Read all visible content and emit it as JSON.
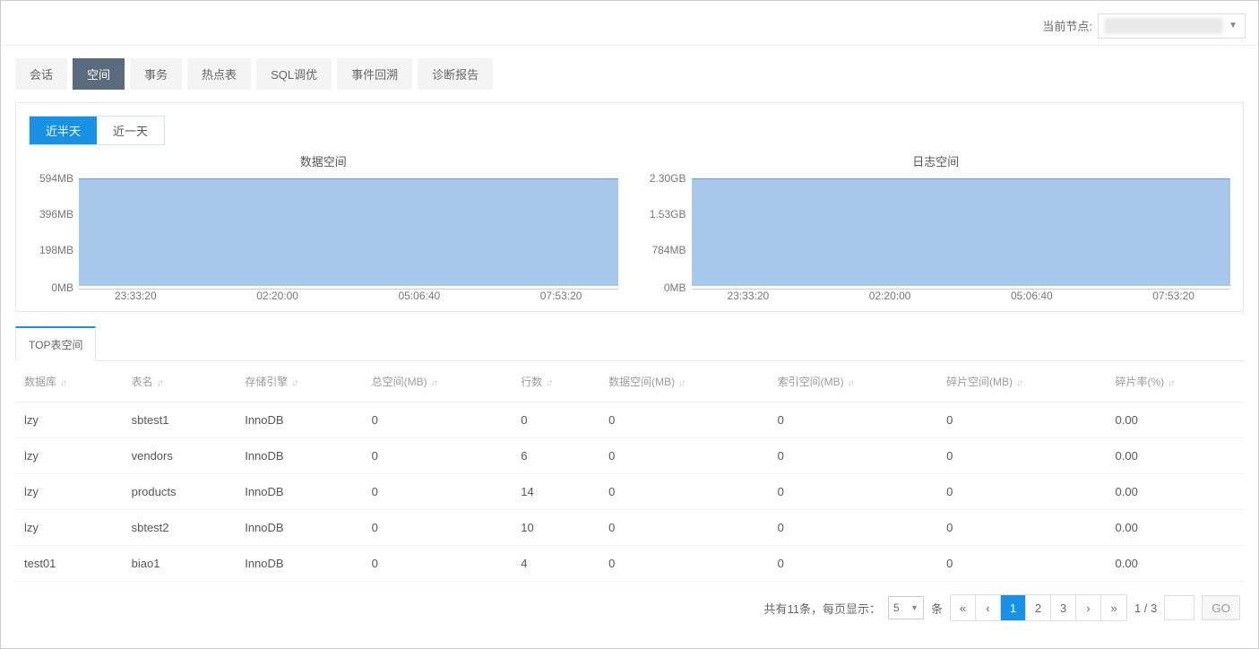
{
  "header": {
    "current_node_label": "当前节点:",
    "current_node_value": ""
  },
  "nav_tabs": [
    "会话",
    "空间",
    "事务",
    "热点表",
    "SQL调优",
    "事件回溯",
    "诊断报告"
  ],
  "nav_active_index": 1,
  "range_toggle": {
    "options": [
      "近半天",
      "近一天"
    ],
    "active_index": 0
  },
  "chart_data": [
    {
      "type": "area",
      "title": "数据空间",
      "y_ticks": [
        "0MB",
        "198MB",
        "396MB",
        "594MB"
      ],
      "ylim": [
        0,
        594
      ],
      "x_ticks": [
        "23:33:20",
        "02:20:00",
        "05:06:40",
        "07:53:20"
      ],
      "series": [
        {
          "name": "数据空间",
          "value_constant_mb": 594
        }
      ]
    },
    {
      "type": "area",
      "title": "日志空间",
      "y_ticks": [
        "0MB",
        "784MB",
        "1.53GB",
        "2.30GB"
      ],
      "ylim": [
        0,
        2355
      ],
      "x_ticks": [
        "23:33:20",
        "02:20:00",
        "05:06:40",
        "07:53:20"
      ],
      "series": [
        {
          "name": "日志空间",
          "value_constant_mb": 2355
        }
      ]
    }
  ],
  "sub_tab": "TOP表空间",
  "table": {
    "columns": [
      "数据库",
      "表名",
      "存储引擎",
      "总空间(MB)",
      "行数",
      "数据空间(MB)",
      "索引空间(MB)",
      "碎片空间(MB)",
      "碎片率(%)"
    ],
    "rows": [
      {
        "db": "lzy",
        "table": "sbtest1",
        "engine": "InnoDB",
        "total": "0",
        "rows": "0",
        "data": "0",
        "idx": "0",
        "frag": "0",
        "rate": "0.00"
      },
      {
        "db": "lzy",
        "table": "vendors",
        "engine": "InnoDB",
        "total": "0",
        "rows": "6",
        "data": "0",
        "idx": "0",
        "frag": "0",
        "rate": "0.00"
      },
      {
        "db": "lzy",
        "table": "products",
        "engine": "InnoDB",
        "total": "0",
        "rows": "14",
        "data": "0",
        "idx": "0",
        "frag": "0",
        "rate": "0.00"
      },
      {
        "db": "lzy",
        "table": "sbtest2",
        "engine": "InnoDB",
        "total": "0",
        "rows": "10",
        "data": "0",
        "idx": "0",
        "frag": "0",
        "rate": "0.00"
      },
      {
        "db": "test01",
        "table": "biao1",
        "engine": "InnoDB",
        "total": "0",
        "rows": "4",
        "data": "0",
        "idx": "0",
        "frag": "0",
        "rate": "0.00"
      }
    ]
  },
  "pager": {
    "summary_prefix": "共有",
    "total": "11",
    "summary_mid": "条，每页显示：",
    "page_size": "5",
    "unit": "条",
    "pages": [
      "1",
      "2",
      "3"
    ],
    "active_page_index": 0,
    "page_of": "1 / 3",
    "go": "GO"
  }
}
